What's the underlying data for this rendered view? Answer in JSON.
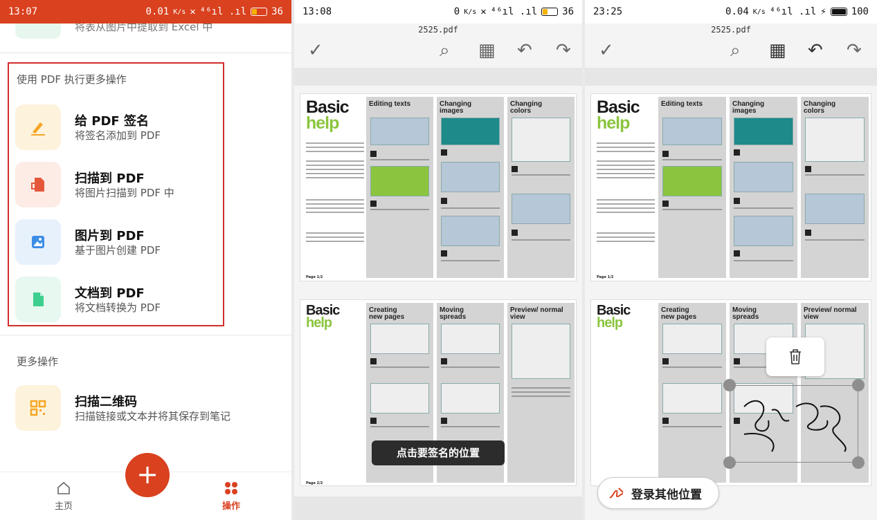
{
  "screen1": {
    "status": {
      "time": "13:07",
      "speed": "0.01",
      "speed_unit": "K/s",
      "signal": "⁴⁶ıl .ıl",
      "battery": "36"
    },
    "top_item_text": "将表从图片中提取到 Excel 中",
    "section_more_pdf": "使用 PDF 执行更多操作",
    "items": [
      {
        "title": "给 PDF 签名",
        "sub": "将签名添加到 PDF",
        "icon": "pen-sign-icon"
      },
      {
        "title": "扫描到 PDF",
        "sub": "将图片扫描到 PDF 中",
        "icon": "scan-to-pdf-icon"
      },
      {
        "title": "图片到 PDF",
        "sub": "基于图片创建 PDF",
        "icon": "image-to-pdf-icon"
      },
      {
        "title": "文档到 PDF",
        "sub": "将文档转换为 PDF",
        "icon": "doc-to-pdf-icon"
      }
    ],
    "section_more_ops": "更多操作",
    "qr_item": {
      "title": "扫描二维码",
      "sub": "扫描链接或文本并将其保存到笔记"
    },
    "nav": {
      "home": "主页",
      "ops": "操作",
      "fab": "+"
    },
    "colors": {
      "accent": "#d9411f",
      "highlight_box": "#d22b2b"
    }
  },
  "screen2": {
    "status": {
      "time": "13:08",
      "speed": "0",
      "speed_unit": "K/s",
      "signal": "⁴⁶ıl .ıl",
      "battery": "36"
    },
    "filename": "2525.pdf",
    "toast": "点击要签名的位置"
  },
  "screen3": {
    "status": {
      "time": "23:25",
      "speed": "0.04",
      "speed_unit": "K/s",
      "signal": "⁴⁶ıl .ıl",
      "battery": "100"
    },
    "filename": "2525.pdf",
    "login_button": "登录其他位置"
  },
  "pdf": {
    "page1": {
      "title1": "Basic",
      "title2": "help",
      "columns": [
        "Editing texts",
        "Changing images",
        "Changing colors"
      ],
      "footer": "Page 1/2"
    },
    "page2": {
      "title1": "Basic",
      "title2": "help",
      "columns": [
        "Creating new pages",
        "Moving spreads",
        "Preview/ normal view"
      ],
      "footer": "Page 2/2"
    }
  }
}
